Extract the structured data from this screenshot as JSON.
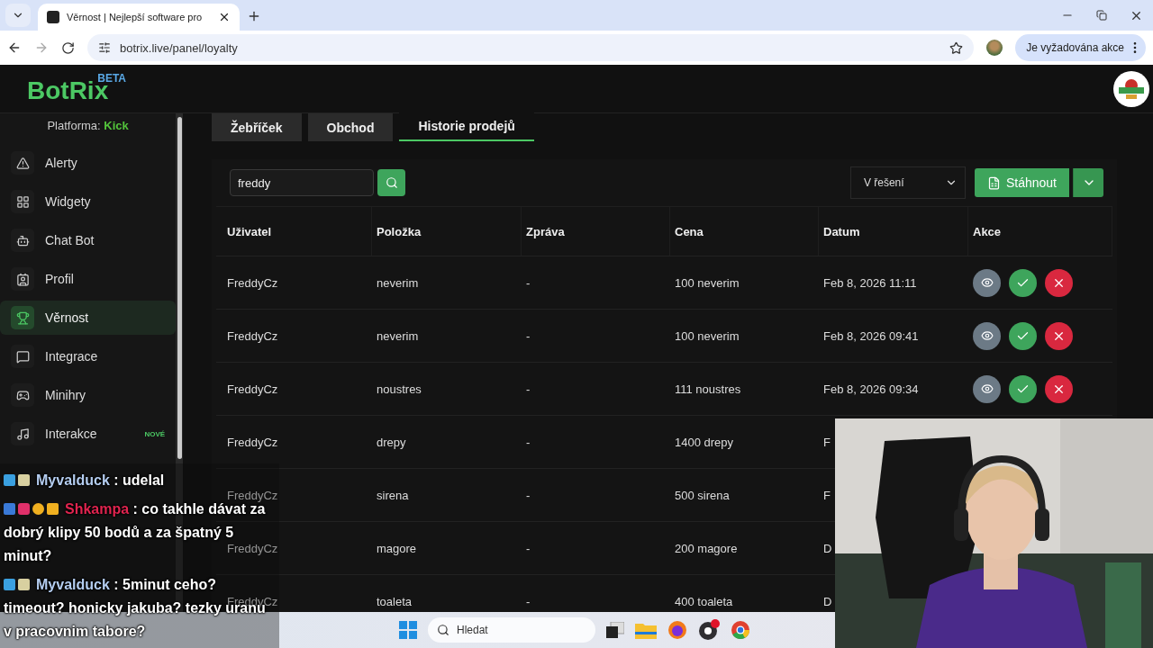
{
  "browser": {
    "tab_title": "Věrnost | Nejlepší software pro",
    "url": "botrix.live/panel/loyalty",
    "action_chip": "Je vyžadována akce"
  },
  "app": {
    "logo": "BotRix",
    "logo_badge": "BETA",
    "platform_label": "Platforma:",
    "platform": "Kick"
  },
  "sidebar": {
    "items": [
      {
        "label": "Alerty",
        "selected": false
      },
      {
        "label": "Widgety",
        "selected": false
      },
      {
        "label": "Chat Bot",
        "selected": false
      },
      {
        "label": "Profil",
        "selected": false
      },
      {
        "label": "Věrnost",
        "selected": true
      },
      {
        "label": "Integrace",
        "selected": false
      },
      {
        "label": "Minihry",
        "selected": false
      },
      {
        "label": "Interakce",
        "selected": false,
        "badge": "NOVÉ"
      }
    ]
  },
  "tabs": [
    {
      "label": "Žebříček",
      "selected": false
    },
    {
      "label": "Obchod",
      "selected": false
    },
    {
      "label": "Historie prodejů",
      "selected": true
    }
  ],
  "search": {
    "value": "freddy"
  },
  "filter": "V řešení",
  "download": "Stáhnout",
  "table": {
    "columns": [
      "Uživatel",
      "Položka",
      "Zpráva",
      "Cena",
      "Datum",
      "Akce"
    ],
    "rows": [
      {
        "cells": [
          "FreddyCz",
          "neverim",
          "-",
          "100 neverim",
          "Feb 8, 2026 11:11"
        ],
        "show_actions": true
      },
      {
        "cells": [
          "FreddyCz",
          "neverim",
          "-",
          "100 neverim",
          "Feb 8, 2026 09:41"
        ],
        "show_actions": true
      },
      {
        "cells": [
          "FreddyCz",
          "noustres",
          "-",
          "111 noustres",
          "Feb 8, 2026 09:34"
        ],
        "show_actions": true
      },
      {
        "cells": [
          "FreddyCz",
          "drepy",
          "-",
          "1400 drepy",
          "F"
        ]
      },
      {
        "cells": [
          "FreddyCz",
          "sirena",
          "-",
          "500 sirena",
          "F"
        ]
      },
      {
        "cells": [
          "FreddyCz",
          "magore",
          "-",
          "200 magore",
          "D"
        ]
      },
      {
        "cells": [
          "FreddyCz",
          "toaleta",
          "-",
          "400 toaleta",
          "D"
        ]
      }
    ]
  },
  "chat": [
    {
      "user": "Myvalduck",
      "color": "#b4cdf0",
      "text": ": udelal"
    },
    {
      "user": "Shkampa",
      "color": "#e0244f",
      "text": ": co takhle dávat za dobrý klipy 50 bodů a za špatný 5 minut?"
    },
    {
      "user": "Myvalduck",
      "color": "#b4cdf0",
      "text": ": 5minut ceho? timeout? honicky jakuba? tezky uranu v pracovnim tabore?"
    }
  ],
  "taskbar": {
    "search_placeholder": "Hledat"
  }
}
